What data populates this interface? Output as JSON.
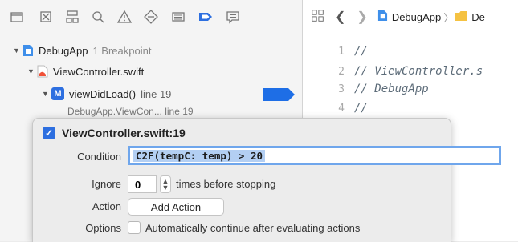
{
  "navigator": {
    "toolbar_icons": [
      "folder-icon",
      "source-control-icon",
      "hierarchy-icon",
      "search-icon",
      "warning-icon",
      "test-diamond-icon",
      "debug-list-icon",
      "breakpoint-icon",
      "report-icon"
    ],
    "tree": {
      "project": {
        "name": "DebugApp",
        "detail": "1 Breakpoint"
      },
      "file": {
        "name": "ViewController.swift"
      },
      "method": {
        "badge": "M",
        "name": "viewDidLoad()",
        "detail": "line 19"
      },
      "partial": {
        "text": "DebugApp.ViewCon...  line 19"
      }
    }
  },
  "editor": {
    "breadcrumb": [
      "DebugApp",
      "De"
    ],
    "lines": [
      {
        "num": "1",
        "text": "//"
      },
      {
        "num": "2",
        "text": "//  ViewController.s"
      },
      {
        "num": "3",
        "text": "//  DebugApp"
      },
      {
        "num": "4",
        "text": "//"
      }
    ]
  },
  "popover": {
    "title": "ViewController.swift:19",
    "condition_label": "Condition",
    "condition_value": "C2F(tempC: temp) > 20",
    "ignore_label": "Ignore",
    "ignore_value": "0",
    "ignore_suffix": "times before stopping",
    "action_label": "Action",
    "add_action_button": "Add Action",
    "options_label": "Options",
    "options_checkbox_label": "Automatically continue after evaluating actions"
  },
  "colors": {
    "accent": "#2d6fe0",
    "breakpoint": "#1e6ee6",
    "focus_ring": "#6fa6ec"
  }
}
